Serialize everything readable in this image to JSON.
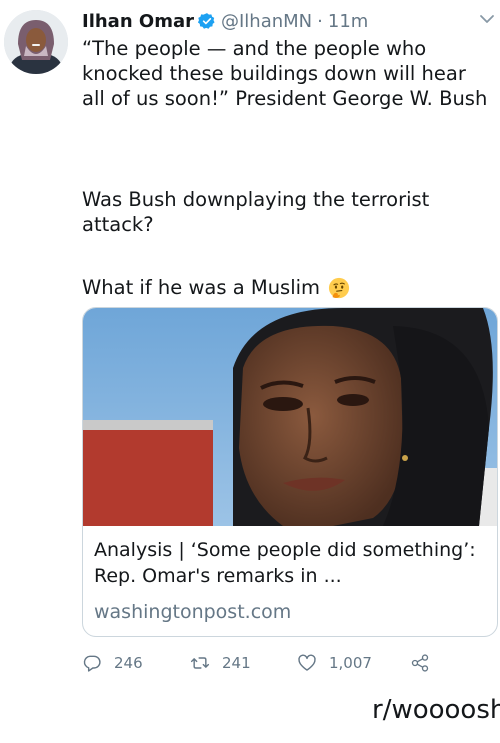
{
  "tweet": {
    "author_name": "Ilhan Omar",
    "handle": "@IlhanMN",
    "separator": "·",
    "time": "11m",
    "paragraphs": [
      "“The people — and the people who knocked these buildings down will hear all of us soon!” President George W. Bush",
      "Was Bush downplaying the terrorist attack?",
      "What if he was a Muslim"
    ],
    "emoji": "thinking-face",
    "verified_color": "#1da1f2"
  },
  "card": {
    "title": "Analysis | ‘Some people did something’: Rep. Omar's remarks in ...",
    "domain": "washingtonpost.com"
  },
  "actions": {
    "replies": "246",
    "retweets": "241",
    "likes": "1,007"
  },
  "caption": "r/woooosh",
  "colors": {
    "secondary_text": "#657786",
    "border": "#ccd6dd",
    "accent": "#1da1f2"
  }
}
